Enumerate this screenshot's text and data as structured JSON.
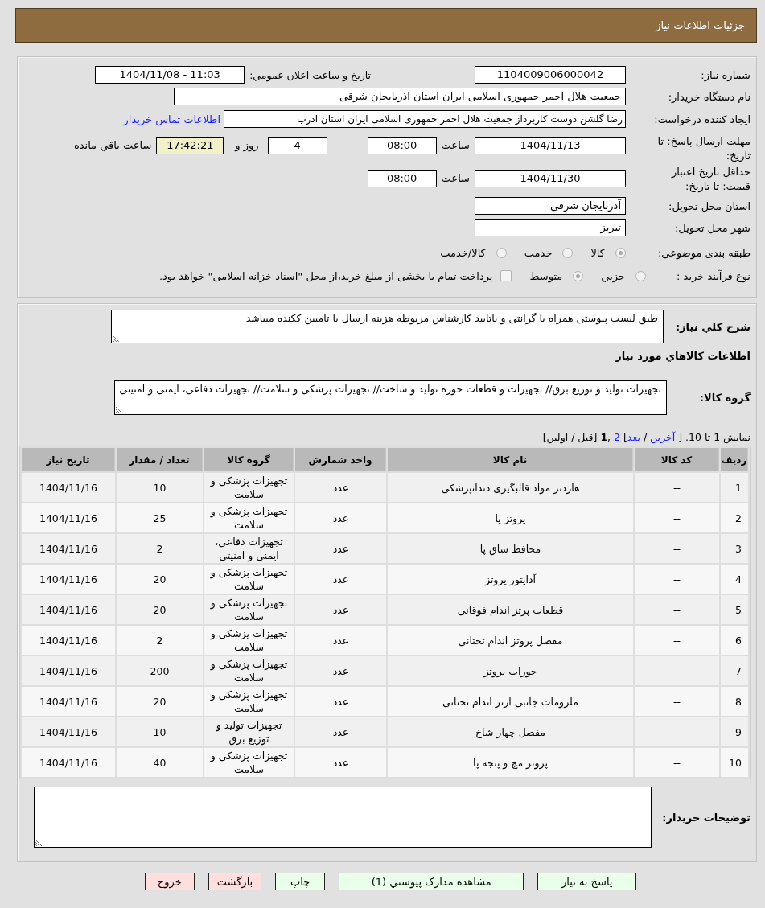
{
  "header": {
    "title": "جزئیات اطلاعات نیاز"
  },
  "details": {
    "need_number": {
      "label": "شماره نیاز:",
      "value": "1104009006000042"
    },
    "announce": {
      "label": "تاریخ و ساعت اعلان عمومي:",
      "value": "1404/11/08 - 11:03"
    },
    "buyer_org": {
      "label": "نام دستگاه خریدار:",
      "value": "جمعیت هلال احمر جمهوری اسلامی ایران استان اذربایجان شرقی"
    },
    "requester": {
      "label": "ایجاد کننده درخواست:",
      "value": "رضا گلشن دوست کاربرداز جمعیت هلال احمر جمهوری اسلامی ایران استان اذرب",
      "link": "اطلاعات تماس خریدار"
    },
    "deadline": {
      "label": "مهلت ارسال پاسخ: تا تاریخ:",
      "date": "1404/11/13",
      "time_label": "ساعت",
      "time": "08:00",
      "days": "4",
      "days_label": "روز و",
      "remaining": "17:42:21",
      "remaining_label": "ساعت باقي مانده"
    },
    "validity": {
      "label": "حداقل تاریخ اعتبار قیمت: تا تاریخ:",
      "date": "1404/11/30",
      "time_label": "ساعت",
      "time": "08:00"
    },
    "province": {
      "label": "استان محل تحویل:",
      "value": "آذربایجان شرقی"
    },
    "city": {
      "label": "شهر محل تحویل:",
      "value": "تبریز"
    },
    "category": {
      "label": "طبقه بندی موضوعی:",
      "options": [
        {
          "label": "کالا",
          "selected": true
        },
        {
          "label": "خدمت",
          "selected": false
        },
        {
          "label": "کالا/خدمت",
          "selected": false
        }
      ]
    },
    "process": {
      "label": "نوع فرآیند خرید :",
      "options": [
        {
          "label": "جزيي",
          "selected": false
        },
        {
          "label": "متوسط",
          "selected": true
        }
      ],
      "treasury": {
        "checked": false,
        "label": "پرداخت تمام یا بخشی از مبلغ خرید،از محل \"اسناد خزانه اسلامی\" خواهد بود."
      }
    }
  },
  "need": {
    "description": {
      "label": "شرح کلي نیاز:",
      "value": "طبق لیست پیوستی همراه با گرانتی و باتایید کارشناس مربوطه هزینه ارسال با تامیین ککنده میباشد"
    },
    "goods_heading": "اطلاعات کالاهاي مورد نیاز",
    "goods_group": {
      "label": "گروه کالا:",
      "value": "تجهیزات تولید و توزیع برق// تجهیزات و قطعات حوزه تولید و ساخت// تجهیزات پزشکی و سلامت// تجهیزات دفاعی، ایمنی و امنیتی"
    },
    "pager": [
      {
        "kind": "text",
        "text": "نمایش 1 تا 10. [ "
      },
      {
        "kind": "link",
        "text": "آخرین"
      },
      {
        "kind": "text",
        "text": " / "
      },
      {
        "kind": "link",
        "text": "بعد"
      },
      {
        "kind": "text",
        "text": "] "
      },
      {
        "kind": "link",
        "text": "2"
      },
      {
        "kind": "text",
        "text": " ,"
      },
      {
        "kind": "current",
        "text": "1"
      },
      {
        "kind": "text",
        "text": " [قبل / اولین]"
      }
    ],
    "table": {
      "columns": [
        "ردیف",
        "کد کالا",
        "نام کالا",
        "واحد شمارش",
        "گروه کالا",
        "تعداد / مقدار",
        "تاریخ نیاز"
      ],
      "rows": [
        [
          "1",
          "--",
          "هاردنر مواد قالبگیری دندانپزشکی",
          "عدد",
          "تجهیزات پزشکی و سلامت",
          "10",
          "1404/11/16"
        ],
        [
          "2",
          "--",
          "پروتز پا",
          "عدد",
          "تجهیزات پزشکی و سلامت",
          "25",
          "1404/11/16"
        ],
        [
          "3",
          "--",
          "محافظ ساق پا",
          "عدد",
          "تجهیزات دفاعی، ایمنی و امنیتی",
          "2",
          "1404/11/16"
        ],
        [
          "4",
          "--",
          "آداپتور پروتز",
          "عدد",
          "تجهیزات پزشکی و سلامت",
          "20",
          "1404/11/16"
        ],
        [
          "5",
          "--",
          "قطعات پرتز اندام فوقانی",
          "عدد",
          "تجهیزات پزشکی و سلامت",
          "20",
          "1404/11/16"
        ],
        [
          "6",
          "--",
          "مفصل پروتز اندام تحتانی",
          "عدد",
          "تجهیزات پزشکی و سلامت",
          "2",
          "1404/11/16"
        ],
        [
          "7",
          "--",
          "جوراب پروتز",
          "عدد",
          "تجهیزات پزشکی و سلامت",
          "200",
          "1404/11/16"
        ],
        [
          "8",
          "--",
          "ملزومات جانبی ارتز اندام تحتانی",
          "عدد",
          "تجهیزات پزشکی و سلامت",
          "20",
          "1404/11/16"
        ],
        [
          "9",
          "--",
          "مفصل چهار شاخ",
          "عدد",
          "تجهیزات تولید و توزیع برق",
          "10",
          "1404/11/16"
        ],
        [
          "10",
          "--",
          "پروتز مچ و پنجه پا",
          "عدد",
          "تجهیزات پزشکی و سلامت",
          "40",
          "1404/11/16"
        ]
      ]
    },
    "buyer_notes": {
      "label": "توضیحات خریدار:"
    }
  },
  "buttons": [
    {
      "label": "پاسخ به نیاز",
      "color": "#eaffea"
    },
    {
      "label": "مشاهده مدارک پیوستي (1)",
      "color": "#eaffea"
    },
    {
      "label": "چاپ",
      "color": "#eaffea"
    },
    {
      "label": "بازگشت",
      "color": "#ffdede"
    },
    {
      "label": "خروج",
      "color": "#ffdede"
    }
  ]
}
